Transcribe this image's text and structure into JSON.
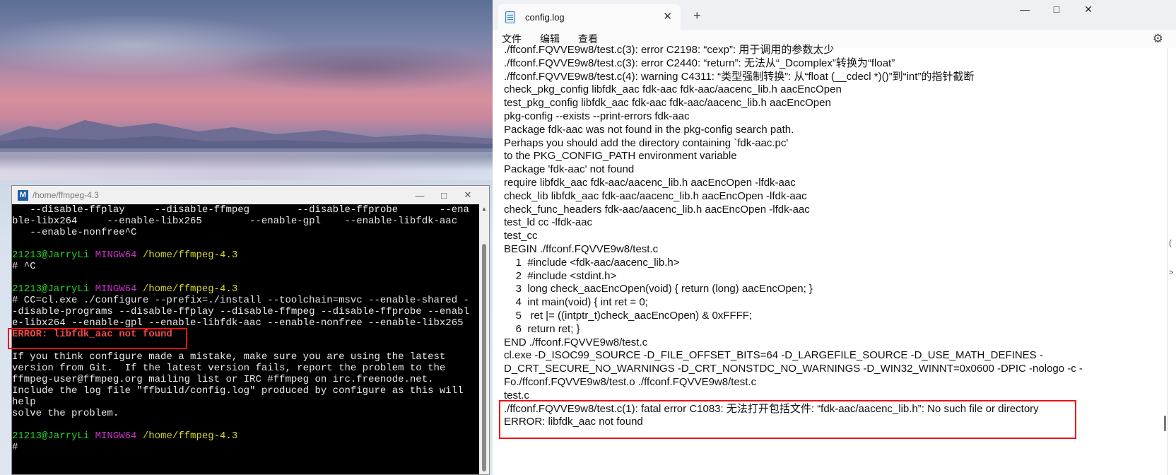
{
  "terminal": {
    "title": "/home/ffmpeg-4.3",
    "icon": "msys2-icon",
    "lines": [
      {
        "parts": [
          {
            "t": "   --disable-ffplay     --disable-ffmpeg        --disable-ffprobe       --ena",
            "c": "white"
          }
        ]
      },
      {
        "parts": [
          {
            "t": "ble-libx264     --enable-libx265        --enable-gpl    --enable-libfdk-aac",
            "c": "white"
          }
        ]
      },
      {
        "parts": [
          {
            "t": "   --enable-nonfree^C",
            "c": "white"
          }
        ]
      },
      {
        "parts": [
          {
            "t": "",
            "c": "white"
          }
        ]
      },
      {
        "parts": [
          {
            "t": "21213@JarryLi",
            "c": "user"
          },
          {
            "t": " ",
            "c": "white"
          },
          {
            "t": "MINGW64",
            "c": "host"
          },
          {
            "t": " ",
            "c": "white"
          },
          {
            "t": "/home/ffmpeg-4.3",
            "c": "path"
          }
        ]
      },
      {
        "parts": [
          {
            "t": "# ^C",
            "c": "white"
          }
        ]
      },
      {
        "parts": [
          {
            "t": "",
            "c": "white"
          }
        ]
      },
      {
        "parts": [
          {
            "t": "21213@JarryLi",
            "c": "user"
          },
          {
            "t": " ",
            "c": "white"
          },
          {
            "t": "MINGW64",
            "c": "host"
          },
          {
            "t": " ",
            "c": "white"
          },
          {
            "t": "/home/ffmpeg-4.3",
            "c": "path"
          }
        ]
      },
      {
        "parts": [
          {
            "t": "# CC=cl.exe ./configure --prefix=./install --toolchain=msvc --enable-shared -",
            "c": "white"
          }
        ]
      },
      {
        "parts": [
          {
            "t": "-disable-programs --disable-ffplay --disable-ffmpeg --disable-ffprobe --enabl",
            "c": "white"
          }
        ]
      },
      {
        "parts": [
          {
            "t": "e-libx264 --enable-gpl --enable-libfdk-aac --enable-nonfree --enable-libx265",
            "c": "white"
          }
        ]
      },
      {
        "parts": [
          {
            "t": "ERROR: libfdk_aac not found",
            "c": "err"
          }
        ]
      },
      {
        "parts": [
          {
            "t": "",
            "c": "white"
          }
        ]
      },
      {
        "parts": [
          {
            "t": "If you think configure made a mistake, make sure you are using the latest",
            "c": "white"
          }
        ]
      },
      {
        "parts": [
          {
            "t": "version from Git.  If the latest version fails, report the problem to the",
            "c": "white"
          }
        ]
      },
      {
        "parts": [
          {
            "t": "ffmpeg-user@ffmpeg.org mailing list or IRC #ffmpeg on irc.freenode.net.",
            "c": "white"
          }
        ]
      },
      {
        "parts": [
          {
            "t": "Include the log file \"ffbuild/config.log\" produced by configure as this will",
            "c": "white"
          }
        ]
      },
      {
        "parts": [
          {
            "t": "help",
            "c": "white"
          }
        ]
      },
      {
        "parts": [
          {
            "t": "solve the problem.",
            "c": "white"
          }
        ]
      },
      {
        "parts": [
          {
            "t": "",
            "c": "white"
          }
        ]
      },
      {
        "parts": [
          {
            "t": "21213@JarryLi",
            "c": "user"
          },
          {
            "t": " ",
            "c": "white"
          },
          {
            "t": "MINGW64",
            "c": "host"
          },
          {
            "t": " ",
            "c": "white"
          },
          {
            "t": "/home/ffmpeg-4.3",
            "c": "path"
          }
        ]
      },
      {
        "parts": [
          {
            "t": "# ",
            "c": "white"
          }
        ]
      }
    ]
  },
  "notepad": {
    "tab_label": "config.log",
    "menus": [
      "文件",
      "编辑",
      "查看"
    ],
    "lines": [
      "./ffconf.FQVVE9w8/test.c(3): error C2198: “cexp”: 用于调用的参数太少",
      "./ffconf.FQVVE9w8/test.c(3): error C2440: “return”: 无法从“_Dcomplex”转换为“float”",
      "./ffconf.FQVVE9w8/test.c(4): warning C4311: “类型强制转换”: 从“float (__cdecl *)()”到“int”的指针截断",
      "check_pkg_config libfdk_aac fdk-aac fdk-aac/aacenc_lib.h aacEncOpen",
      "test_pkg_config libfdk_aac fdk-aac fdk-aac/aacenc_lib.h aacEncOpen",
      "pkg-config --exists --print-errors fdk-aac",
      "Package fdk-aac was not found in the pkg-config search path.",
      "Perhaps you should add the directory containing `fdk-aac.pc'",
      "to the PKG_CONFIG_PATH environment variable",
      "Package 'fdk-aac' not found",
      "require libfdk_aac fdk-aac/aacenc_lib.h aacEncOpen -lfdk-aac",
      "check_lib libfdk_aac fdk-aac/aacenc_lib.h aacEncOpen -lfdk-aac",
      "check_func_headers fdk-aac/aacenc_lib.h aacEncOpen -lfdk-aac",
      "test_ld cc -lfdk-aac",
      "test_cc",
      "BEGIN ./ffconf.FQVVE9w8/test.c",
      "    1  #include <fdk-aac/aacenc_lib.h>",
      "    2  #include <stdint.h>",
      "    3  long check_aacEncOpen(void) { return (long) aacEncOpen; }",
      "    4  int main(void) { int ret = 0;",
      "    5   ret |= ((intptr_t)check_aacEncOpen) & 0xFFFF;",
      "    6  return ret; }",
      "END ./ffconf.FQVVE9w8/test.c",
      "cl.exe -D_ISOC99_SOURCE -D_FILE_OFFSET_BITS=64 -D_LARGEFILE_SOURCE -D_USE_MATH_DEFINES -",
      "D_CRT_SECURE_NO_WARNINGS -D_CRT_NONSTDC_NO_WARNINGS -D_WIN32_WINNT=0x0600 -DPIC -nologo -c -",
      "Fo./ffconf.FQVVE9w8/test.o ./ffconf.FQVVE9w8/test.c",
      "test.c",
      "./ffconf.FQVVE9w8/test.c(1): fatal error C1083: 无法打开包括文件: “fdk-aac/aacenc_lib.h”: No such file or directory",
      "ERROR: libfdk_aac not found"
    ]
  },
  "colors": {
    "highlight_box": "#e11111",
    "terminal_user": "#26d42a",
    "terminal_host": "#c833c8",
    "terminal_path": "#d5d52a",
    "terminal_error": "#ef4848"
  }
}
